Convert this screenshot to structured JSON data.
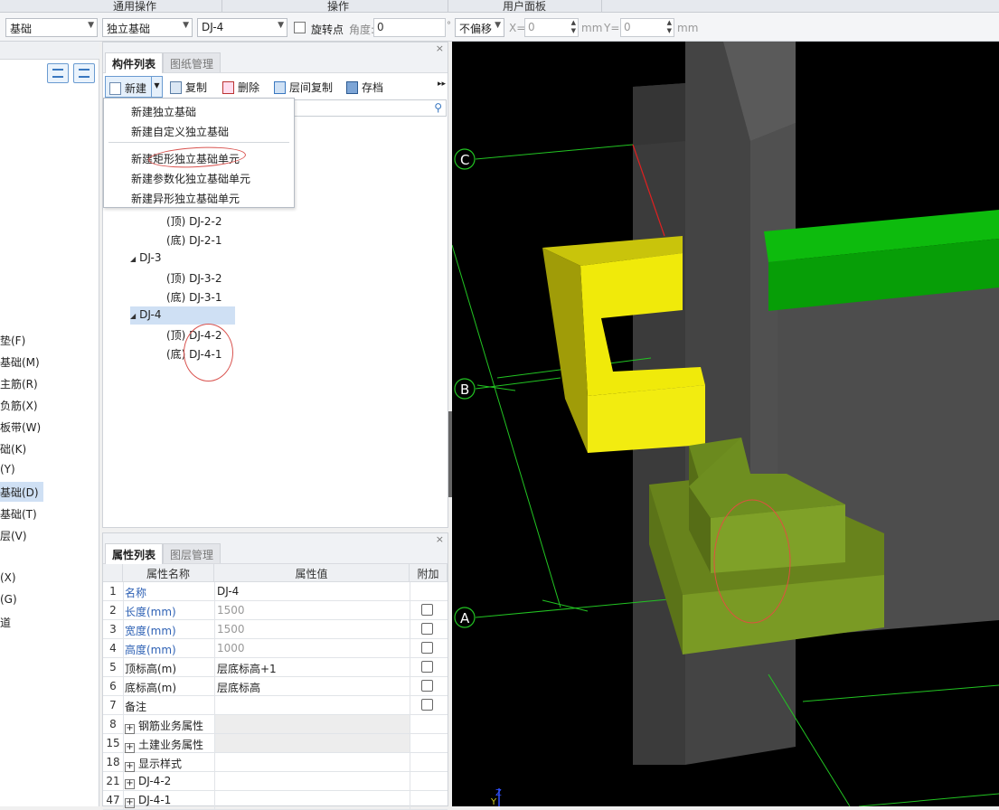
{
  "header_groups": [
    "通用操作",
    "操作",
    "用户面板"
  ],
  "toolbar": {
    "floor_select": "基础",
    "type_select": "独立基础",
    "item_select": "DJ-4",
    "rotate_label": "旋转点",
    "angle_label": "角度:",
    "angle_value": "0",
    "degree_sign": "°",
    "offset_select": "不偏移",
    "x_label": "X=",
    "x_value": "0",
    "y_label": "Y=",
    "y_value": "0",
    "unit": "mm"
  },
  "left_strip": {
    "items": [
      "垫(F)",
      "基础(M)",
      "主筋(R)",
      "负筋(X)",
      "板带(W)",
      "础(K)",
      "(Y)",
      "基础(D)",
      "基础(T)",
      "层(V)",
      "(X)",
      "(G)",
      "道"
    ],
    "selected_index": 7
  },
  "component_panel": {
    "tabs": [
      "构件列表",
      "图纸管理"
    ],
    "toolbar": {
      "new": "新建",
      "copy": "复制",
      "delete": "删除",
      "floor_copy": "层间复制",
      "save": "存档",
      "more": "▸▸"
    },
    "menu": [
      "新建独立基础",
      "新建自定义独立基础",
      "新建矩形独立基础单元",
      "新建参数化独立基础单元",
      "新建异形独立基础单元"
    ],
    "tree": [
      {
        "label": "(顶)  DJ-2-2"
      },
      {
        "label": "(底)  DJ-2-1"
      },
      {
        "label": "DJ-3"
      },
      {
        "label": "(顶)  DJ-3-2"
      },
      {
        "label": "(底)  DJ-3-1"
      },
      {
        "label": "DJ-4"
      },
      {
        "label": "(顶)  DJ-4-2"
      },
      {
        "label": "(底)  DJ-4-1"
      }
    ]
  },
  "property_panel": {
    "tabs": [
      "属性列表",
      "图层管理"
    ],
    "columns": [
      "属性名称",
      "属性值",
      "附加"
    ],
    "rows": [
      {
        "num": "1",
        "name": "名称",
        "value": "DJ-4"
      },
      {
        "num": "2",
        "name": "长度(mm)",
        "value": "1500"
      },
      {
        "num": "3",
        "name": "宽度(mm)",
        "value": "1500"
      },
      {
        "num": "4",
        "name": "高度(mm)",
        "value": "1000"
      },
      {
        "num": "5",
        "name": "顶标高(m)",
        "value": "层底标高+1"
      },
      {
        "num": "6",
        "name": "底标高(m)",
        "value": "层底标高"
      },
      {
        "num": "7",
        "name": "备注",
        "value": ""
      },
      {
        "num": "8",
        "name": "钢筋业务属性",
        "value": ""
      },
      {
        "num": "15",
        "name": "土建业务属性",
        "value": ""
      },
      {
        "num": "18",
        "name": "显示样式",
        "value": ""
      },
      {
        "num": "21",
        "name": "DJ-4-2",
        "value": ""
      },
      {
        "num": "47",
        "name": "DJ-4-1",
        "value": ""
      }
    ]
  },
  "viewport": {
    "axes": [
      "C",
      "B",
      "A"
    ],
    "coord_label": "Z",
    "coord_label_y": "Y",
    "colors": {
      "yellow": "#f0ea0a",
      "green": "#079e07",
      "olive": "#7a9a24",
      "grid": "#22c422"
    }
  }
}
